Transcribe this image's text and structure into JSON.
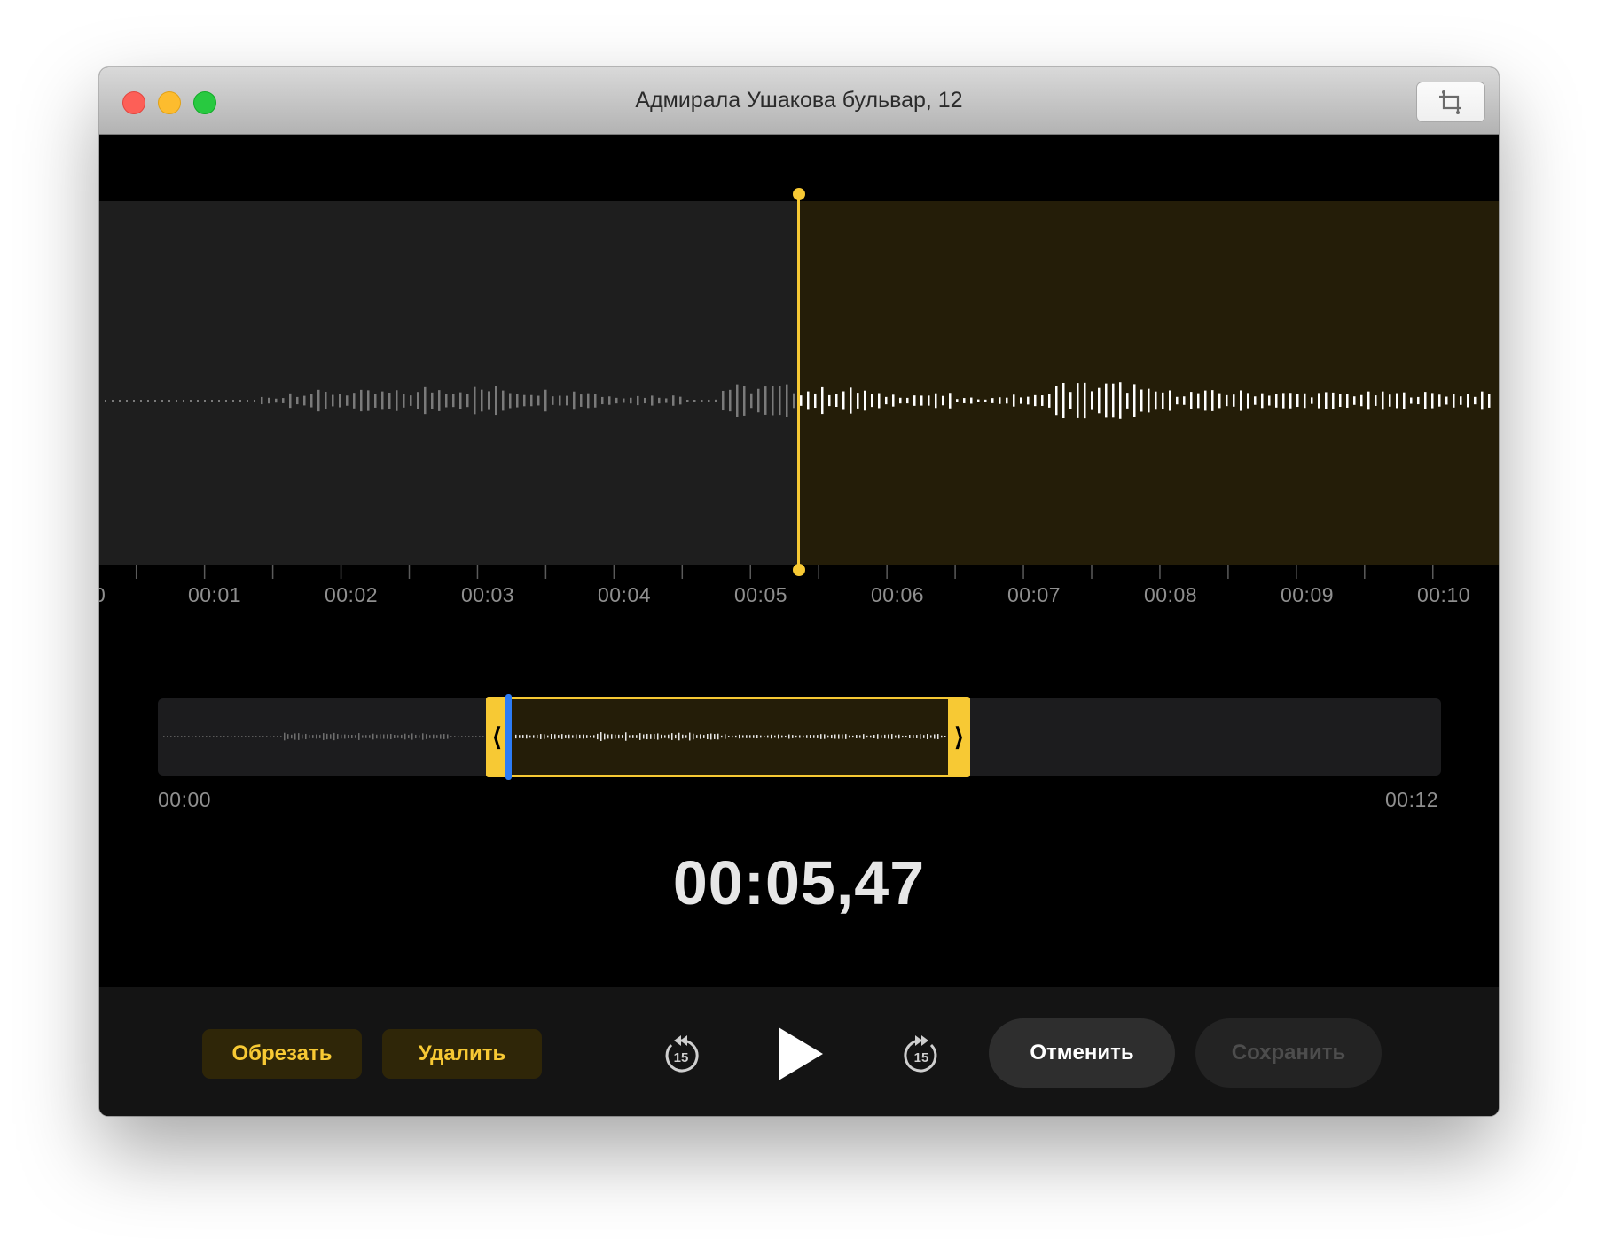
{
  "window": {
    "title": "Адмирала Ушакова бульвар, 12"
  },
  "titlebar_buttons": [
    "close-icon",
    "minimize-icon",
    "maximize-icon"
  ],
  "trim_toolbar_icon": "crop-icon",
  "colors": {
    "accent": "#f7c934",
    "scrubber": "#2c7cf6",
    "played_background": "#1e1e1e",
    "unplayed_background": "#241d08"
  },
  "main_waveform": {
    "ruler_labels": [
      "0",
      "00:01",
      "00:02",
      "00:03",
      "00:04",
      "00:05",
      "00:06",
      "00:07",
      "00:08",
      "00:09",
      "00:10"
    ]
  },
  "overview": {
    "start_time": "00:00",
    "end_time": "00:12",
    "left_handle_glyph": "⟨",
    "right_handle_glyph": "⟩"
  },
  "current_time": "00:05,47",
  "toolbar": {
    "trim_label": "Обрезать",
    "delete_label": "Удалить",
    "skip_back_seconds": "15",
    "skip_forward_seconds": "15",
    "cancel_label": "Отменить",
    "save_label": "Сохранить"
  }
}
